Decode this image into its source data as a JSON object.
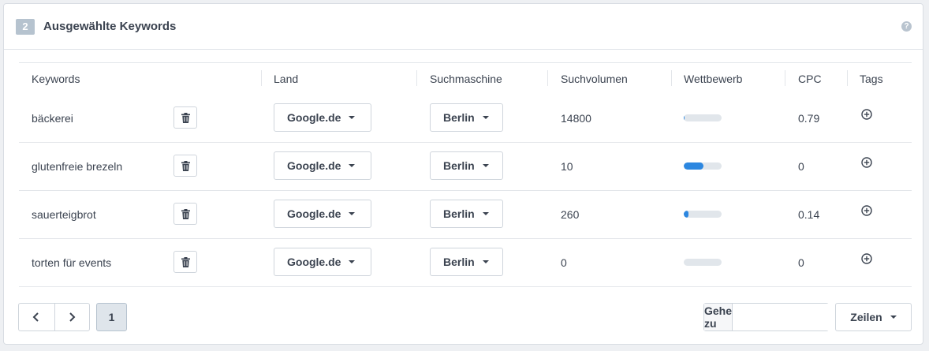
{
  "header": {
    "step": "2",
    "title": "Ausgewählte Keywords",
    "help_icon": "question-circle-icon"
  },
  "table": {
    "columns": [
      "Keywords",
      "Land",
      "Suchmaschine",
      "Suchvolumen",
      "Wettbewerb",
      "CPC",
      "Tags"
    ],
    "rows": [
      {
        "keyword": "bäckerei",
        "land": "Google.de",
        "suchmaschine": "Berlin",
        "suchvolumen": "14800",
        "wettbewerb": 0.02,
        "cpc": "0.79"
      },
      {
        "keyword": "glutenfreie brezeln",
        "land": "Google.de",
        "suchmaschine": "Berlin",
        "suchvolumen": "10",
        "wettbewerb": 0.52,
        "cpc": "0"
      },
      {
        "keyword": "sauerteigbrot",
        "land": "Google.de",
        "suchmaschine": "Berlin",
        "suchvolumen": "260",
        "wettbewerb": 0.12,
        "cpc": "0.14"
      },
      {
        "keyword": "torten für events",
        "land": "Google.de",
        "suchmaschine": "Berlin",
        "suchvolumen": "0",
        "wettbewerb": 0.0,
        "cpc": "0"
      }
    ],
    "icons": {
      "delete": "trash-icon",
      "add_tag": "plus-circle-icon"
    }
  },
  "pagination": {
    "current_page": "1",
    "goto_label": "Gehe zu",
    "goto_value": "",
    "rows_label": "Zeilen"
  },
  "colors": {
    "accent": "#2c87e0",
    "bar_track": "#e1e6eb",
    "badge": "#b6c3cf"
  }
}
